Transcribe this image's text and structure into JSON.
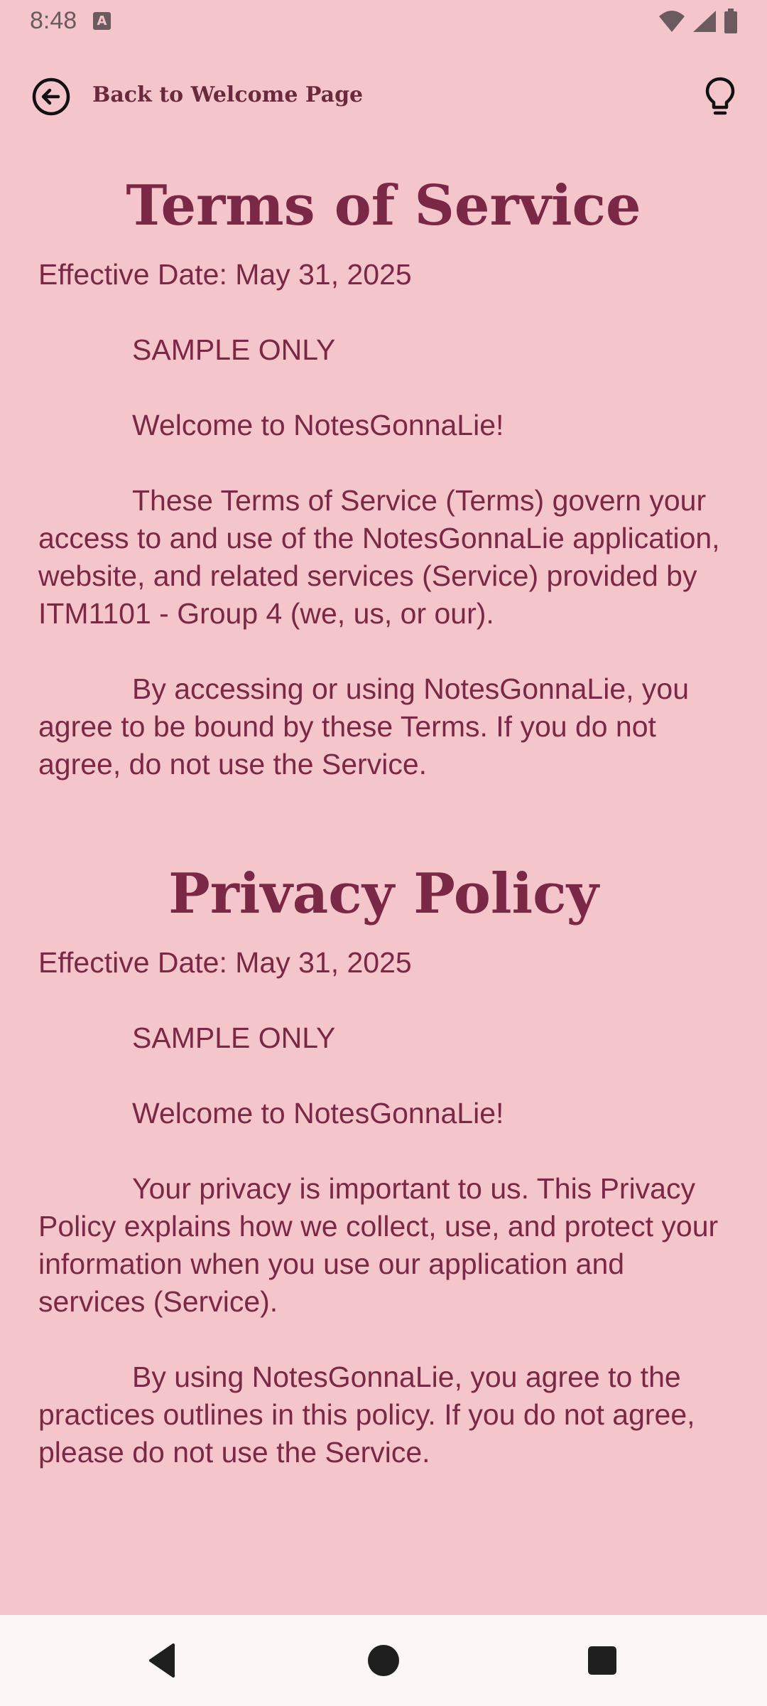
{
  "status_bar": {
    "time": "8:48",
    "notification_icon": "a-badge-icon",
    "icons": [
      "wifi-icon",
      "signal-icon",
      "battery-icon"
    ]
  },
  "top_bar": {
    "back_label": "Back to Welcome Page",
    "back_icon": "arrow-left-circle-icon",
    "action_icon": "lightbulb-icon"
  },
  "terms": {
    "title": "Terms of Service",
    "effective_date": "Effective Date: May 31, 2025",
    "paragraphs": [
      "SAMPLE ONLY",
      "Welcome to NotesGonnaLie!",
      "These Terms of Service (Terms) govern your access to and use of the NotesGonnaLie application, website, and related services (Service) provided by ITM1101 - Group 4 (we, us, or our).",
      "By accessing or using NotesGonnaLie, you agree to be bound by these Terms. If you do not agree, do not use the Service."
    ]
  },
  "privacy": {
    "title": "Privacy Policy",
    "effective_date": "Effective Date: May 31, 2025",
    "paragraphs": [
      "SAMPLE ONLY",
      "Welcome to NotesGonnaLie!",
      "Your privacy is important to us. This Privacy Policy explains how we collect, use, and protect your information when you use our application and services (Service).",
      "By using NotesGonnaLie, you agree to the practices outlines in this policy. If you do not agree, please do not use the Service."
    ]
  },
  "nav_bar": {
    "icons": [
      "nav-back-icon",
      "nav-home-icon",
      "nav-recents-icon"
    ]
  },
  "colors": {
    "background": "#f4c6cb",
    "text": "#7a2845",
    "nav_background": "#fdf6f6"
  }
}
